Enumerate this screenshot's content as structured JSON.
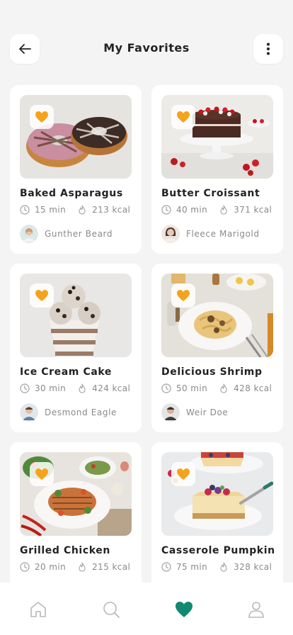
{
  "header": {
    "title": "My Favorites",
    "back_icon": "arrow-left-icon",
    "menu_icon": "more-vertical-icon"
  },
  "colors": {
    "accent": "#f7a21b",
    "active_tab": "#0f8a70",
    "inactive_tab": "#b8b8b8"
  },
  "recipes": [
    {
      "name": "Baked Asparagus",
      "time": "15 min",
      "calories": "213 kcal",
      "author": "Gunther Beard",
      "image": "donuts"
    },
    {
      "name": "Butter Croissant",
      "time": "40 min",
      "calories": "371 kcal",
      "author": "Fleece Marigold",
      "image": "chocolate-cake"
    },
    {
      "name": "Ice Cream Cake",
      "time": "30 min",
      "calories": "424 kcal",
      "author": "Desmond Eagle",
      "image": "ice-cream"
    },
    {
      "name": "Delicious Shrimp",
      "time": "50 min",
      "calories": "428 kcal",
      "author": "Weir Doe",
      "image": "pasta"
    },
    {
      "name": "Grilled Chicken",
      "time": "20 min",
      "calories": "215 kcal",
      "author": "",
      "image": "grilled-chicken"
    },
    {
      "name": "Casserole Pumpkin",
      "time": "75 min",
      "calories": "328 kcal",
      "author": "",
      "image": "cheesecake"
    }
  ],
  "tabs": [
    {
      "icon": "home-icon",
      "active": false
    },
    {
      "icon": "search-icon",
      "active": false
    },
    {
      "icon": "heart-icon",
      "active": true
    },
    {
      "icon": "profile-icon",
      "active": false
    }
  ]
}
